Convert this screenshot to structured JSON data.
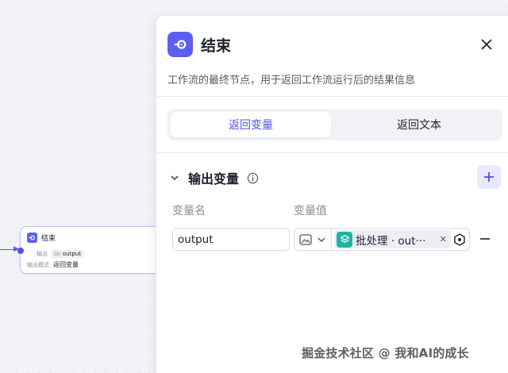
{
  "canvas_node": {
    "title": "结束",
    "output_label": "输出",
    "output_var_type": "Str",
    "output_var": "output",
    "mode_label": "输出模式",
    "mode_value": "返回变量"
  },
  "panel": {
    "title": "结束",
    "description": "工作流的最终节点，用于返回工作流运行后的结果信息",
    "close_icon": "close-icon",
    "tabs": [
      {
        "label": "返回变量",
        "active": true
      },
      {
        "label": "返回文本",
        "active": false
      }
    ],
    "section": {
      "title": "输出变量",
      "info_icon": "info-icon",
      "add_icon": "plus-icon"
    },
    "columns": {
      "name": "变量名",
      "value": "变量值"
    },
    "rows": [
      {
        "name": "output",
        "value_type_icon": "image-type-icon",
        "value_ref": "批处理 · out···",
        "value_ref_icon": "layers-icon"
      }
    ]
  },
  "watermark": "掘金技术社区 @ 我和AI的成长",
  "colors": {
    "accent": "#4d53e8",
    "node_icon": "#5c62f0",
    "ref_icon": "#1fb5a2"
  }
}
